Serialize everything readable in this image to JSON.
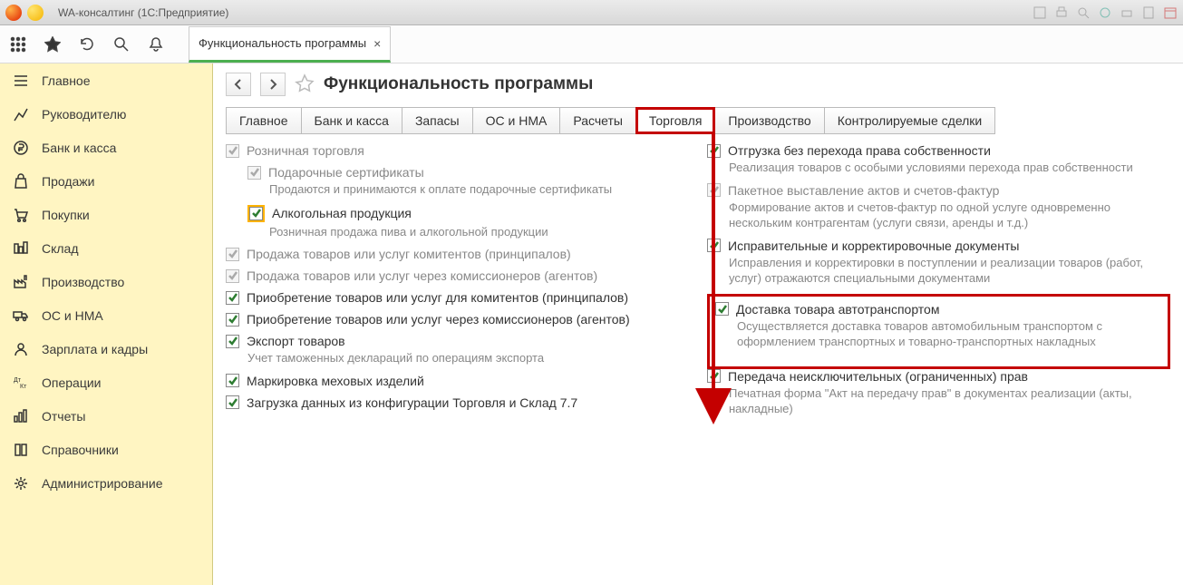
{
  "window": {
    "title": "WA-консалтинг  (1С:Предприятие)"
  },
  "toolbar": {
    "tab_label": "Функциональность программы"
  },
  "page": {
    "title": "Функциональность программы"
  },
  "sidebar": {
    "items": [
      {
        "icon": "menu",
        "label": "Главное"
      },
      {
        "icon": "chart",
        "label": "Руководителю"
      },
      {
        "icon": "ruble",
        "label": "Банк и касса"
      },
      {
        "icon": "bag",
        "label": "Продажи"
      },
      {
        "icon": "cart",
        "label": "Покупки"
      },
      {
        "icon": "warehouse",
        "label": "Склад"
      },
      {
        "icon": "factory",
        "label": "Производство"
      },
      {
        "icon": "truck",
        "label": "ОС и НМА"
      },
      {
        "icon": "person",
        "label": "Зарплата и кадры"
      },
      {
        "icon": "dtkt",
        "label": "Операции"
      },
      {
        "icon": "bars",
        "label": "Отчеты"
      },
      {
        "icon": "book",
        "label": "Справочники"
      },
      {
        "icon": "gear",
        "label": "Администрирование"
      }
    ]
  },
  "tabs": [
    "Главное",
    "Банк и касса",
    "Запасы",
    "ОС и НМА",
    "Расчеты",
    "Торговля",
    "Производство",
    "Контролируемые сделки"
  ],
  "left_opts": [
    {
      "label": "Розничная торговля",
      "checked": true,
      "disabled": true
    },
    {
      "label": "Подарочные сертификаты",
      "checked": true,
      "disabled": true,
      "indent": true,
      "desc": "Продаются и принимаются к оплате подарочные сертификаты"
    },
    {
      "label": "Алкогольная продукция",
      "checked": true,
      "indent": true,
      "desc": "Розничная продажа пива и алкогольной продукции",
      "highlight": true
    },
    {
      "label": "Продажа товаров или услуг комитентов (принципалов)",
      "checked": true,
      "disabled": true
    },
    {
      "label": "Продажа товаров или услуг через комиссионеров (агентов)",
      "checked": true,
      "disabled": true
    },
    {
      "label": "Приобретение товаров или услуг для комитентов (принципалов)",
      "checked": true
    },
    {
      "label": "Приобретение товаров или услуг через комиссионеров (агентов)",
      "checked": true
    },
    {
      "label": "Экспорт товаров",
      "checked": true,
      "desc": "Учет таможенных деклараций по операциям экспорта"
    },
    {
      "label": "Маркировка меховых изделий",
      "checked": true
    },
    {
      "label": "Загрузка данных из конфигурации Торговля и Склад 7.7",
      "checked": true
    }
  ],
  "right_opts": [
    {
      "label": "Отгрузка без перехода права собственности",
      "checked": true,
      "desc": "Реализация товаров с особыми условиями перехода прав собственности"
    },
    {
      "label": "Пакетное выставление актов и счетов-фактур",
      "checked": true,
      "disabled": true,
      "desc": "Формирование актов и счетов-фактур по одной услуге одновременно нескольким контрагентам (услуги связи, аренды и т.д.)"
    },
    {
      "label": "Исправительные и корректировочные документы",
      "checked": true,
      "desc": "Исправления и корректировки в поступлении и реализации товаров (работ, услуг) отражаются специальными документами"
    },
    {
      "label": "Доставка товара автотранспортом",
      "checked": true,
      "desc": "Осуществляется доставка товаров автомобильным транспортом с оформлением транспортных и товарно-транспортных накладных",
      "boxed": true
    },
    {
      "label": "Передача неисключительных (ограниченных) прав",
      "checked": true,
      "desc": "Печатная форма \"Акт на передачу прав\" в документах реализации (акты, накладные)"
    }
  ]
}
